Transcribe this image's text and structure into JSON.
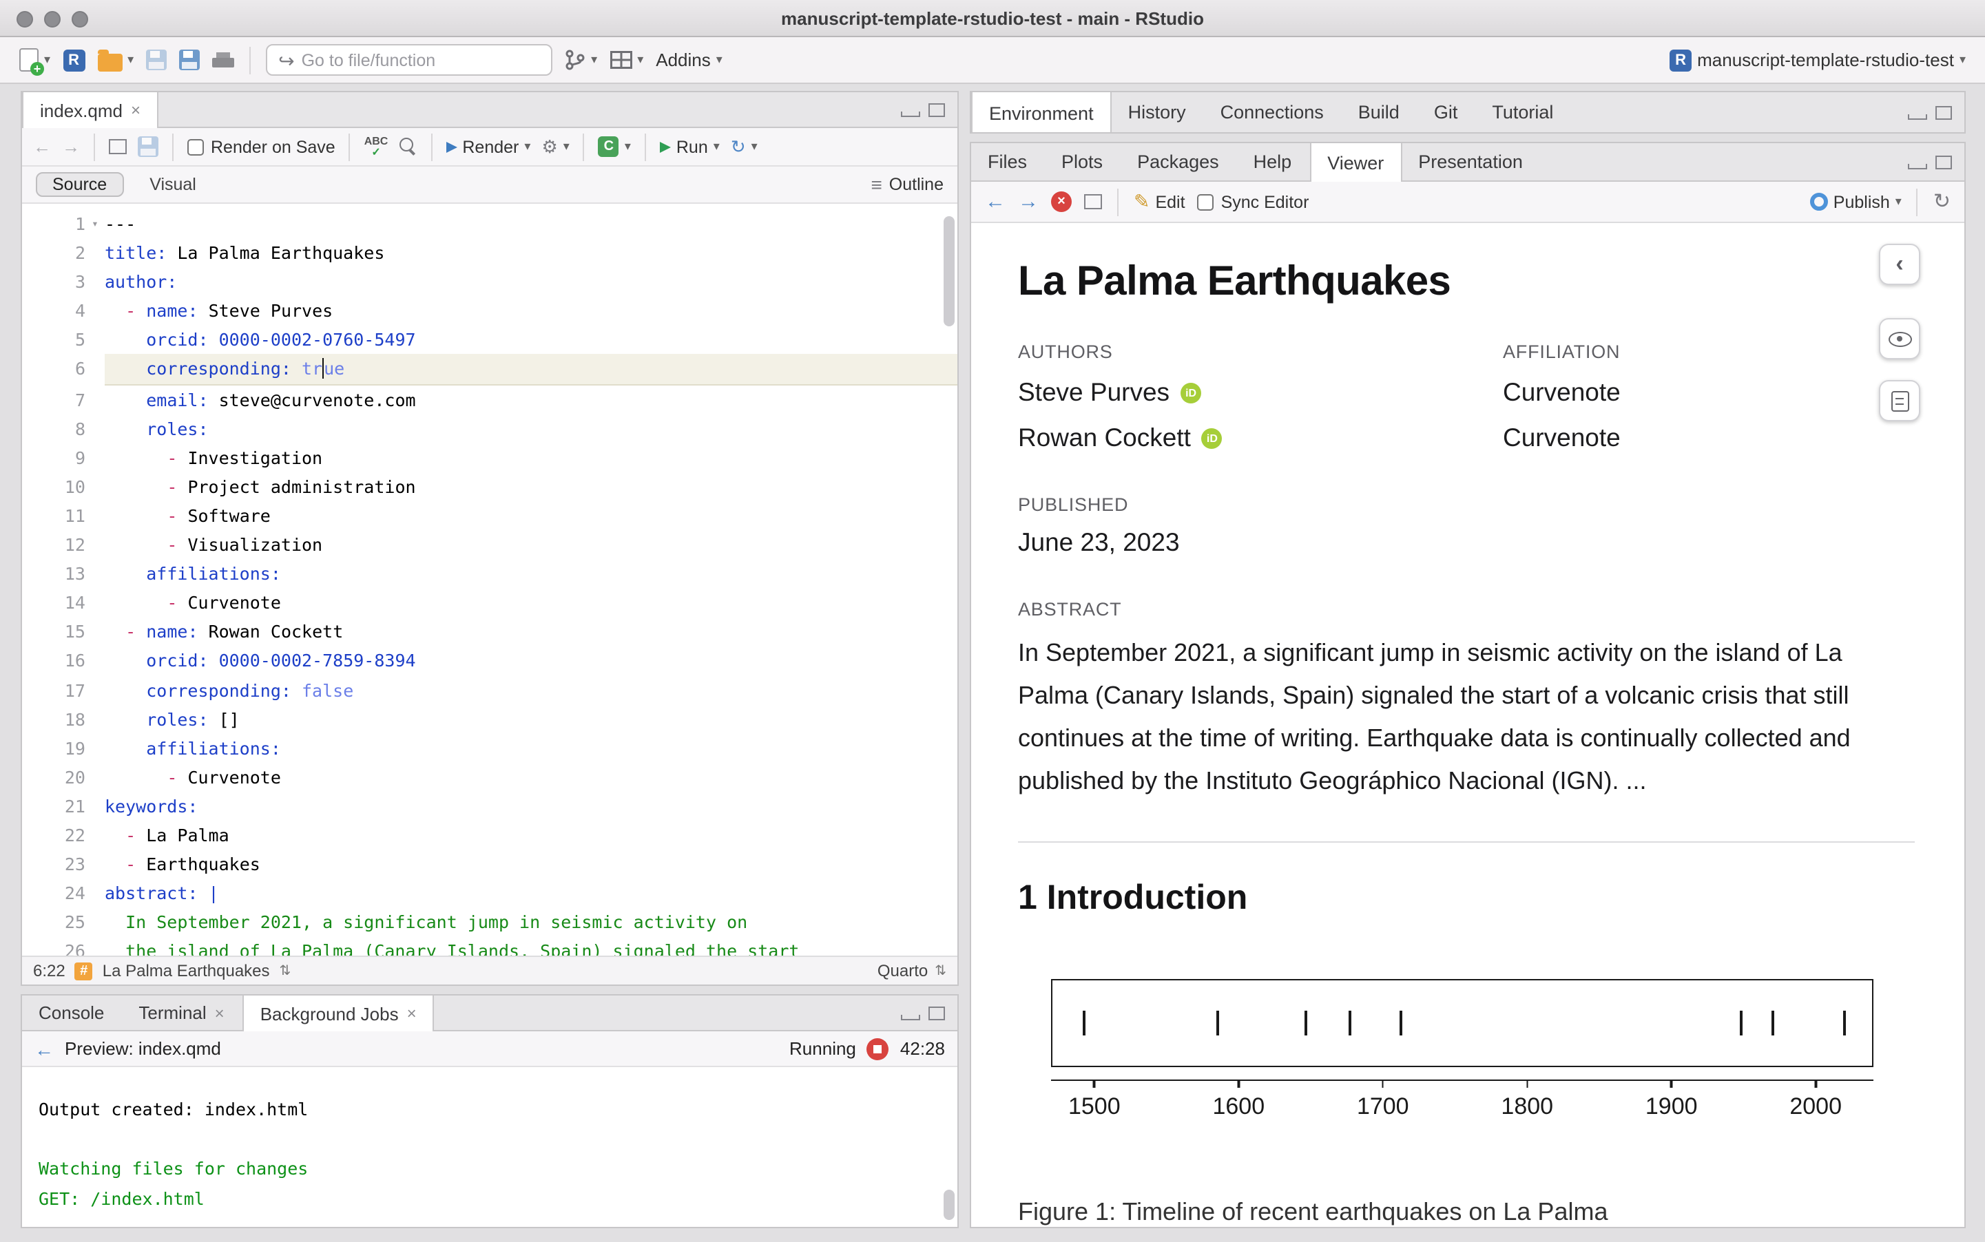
{
  "window": {
    "title": "manuscript-template-rstudio-test - main - RStudio",
    "project": "manuscript-template-rstudio-test"
  },
  "icons": {
    "caret": "▾",
    "back": "←",
    "forward": "→",
    "goto": "↪",
    "gear": "⚙",
    "rerun": "↻",
    "refresh": "↻",
    "pencil": "✎",
    "outline": "≡",
    "spell": "ABC",
    "check": "✓",
    "close": "×",
    "stop_x": "×",
    "chevron_left": "‹",
    "orcid": "iD",
    "hash": "#",
    "updown": "⇅",
    "r_logo": "R",
    "chunk": "C"
  },
  "toolbar": {
    "goto_placeholder": "Go to file/function",
    "addins_label": "Addins"
  },
  "source_pane": {
    "tabs": [
      {
        "label": "index.qmd",
        "closable": true,
        "active": true
      }
    ],
    "toolbar": {
      "render_on_save": "Render on Save",
      "render": "Render",
      "run": "Run"
    },
    "mode_source": "Source",
    "mode_visual": "Visual",
    "outline": "Outline",
    "status": {
      "position": "6:22",
      "symbol": "La Palma Earthquakes",
      "language": "Quarto"
    },
    "lines": [
      {
        "n": 1,
        "fold": true,
        "tokens": [
          [
            "plain",
            "---"
          ]
        ]
      },
      {
        "n": 2,
        "tokens": [
          [
            "key",
            "title:"
          ],
          [
            "plain",
            " La Palma Earthquakes"
          ]
        ]
      },
      {
        "n": 3,
        "tokens": [
          [
            "key",
            "author:"
          ]
        ]
      },
      {
        "n": 4,
        "tokens": [
          [
            "plain",
            "  "
          ],
          [
            "dash",
            "- "
          ],
          [
            "key",
            "name:"
          ],
          [
            "plain",
            " Steve Purves"
          ]
        ]
      },
      {
        "n": 5,
        "tokens": [
          [
            "plain",
            "    "
          ],
          [
            "key",
            "orcid:"
          ],
          [
            "num",
            " 0000-0002-0760-5497"
          ]
        ]
      },
      {
        "n": 6,
        "current": true,
        "tokens": [
          [
            "plain",
            "    "
          ],
          [
            "key",
            "corresponding:"
          ],
          [
            "plain",
            " "
          ],
          [
            "bool",
            "tr"
          ],
          [
            "cursor",
            ""
          ],
          [
            "bool",
            "ue"
          ]
        ]
      },
      {
        "n": 7,
        "tokens": [
          [
            "plain",
            "    "
          ],
          [
            "key",
            "email:"
          ],
          [
            "plain",
            " steve@curvenote.com"
          ]
        ]
      },
      {
        "n": 8,
        "tokens": [
          [
            "plain",
            "    "
          ],
          [
            "key",
            "roles:"
          ]
        ]
      },
      {
        "n": 9,
        "tokens": [
          [
            "plain",
            "      "
          ],
          [
            "dash",
            "- "
          ],
          [
            "plain",
            "Investigation"
          ]
        ]
      },
      {
        "n": 10,
        "tokens": [
          [
            "plain",
            "      "
          ],
          [
            "dash",
            "- "
          ],
          [
            "plain",
            "Project administration"
          ]
        ]
      },
      {
        "n": 11,
        "tokens": [
          [
            "plain",
            "      "
          ],
          [
            "dash",
            "- "
          ],
          [
            "plain",
            "Software"
          ]
        ]
      },
      {
        "n": 12,
        "tokens": [
          [
            "plain",
            "      "
          ],
          [
            "dash",
            "- "
          ],
          [
            "plain",
            "Visualization"
          ]
        ]
      },
      {
        "n": 13,
        "tokens": [
          [
            "plain",
            "    "
          ],
          [
            "key",
            "affiliations:"
          ]
        ]
      },
      {
        "n": 14,
        "tokens": [
          [
            "plain",
            "      "
          ],
          [
            "dash",
            "- "
          ],
          [
            "plain",
            "Curvenote"
          ]
        ]
      },
      {
        "n": 15,
        "tokens": [
          [
            "plain",
            "  "
          ],
          [
            "dash",
            "- "
          ],
          [
            "key",
            "name:"
          ],
          [
            "plain",
            " Rowan Cockett"
          ]
        ]
      },
      {
        "n": 16,
        "tokens": [
          [
            "plain",
            "    "
          ],
          [
            "key",
            "orcid:"
          ],
          [
            "num",
            " 0000-0002-7859-8394"
          ]
        ]
      },
      {
        "n": 17,
        "tokens": [
          [
            "plain",
            "    "
          ],
          [
            "key",
            "corresponding:"
          ],
          [
            "bool",
            " false"
          ]
        ]
      },
      {
        "n": 18,
        "tokens": [
          [
            "plain",
            "    "
          ],
          [
            "key",
            "roles:"
          ],
          [
            "plain",
            " []"
          ]
        ]
      },
      {
        "n": 19,
        "tokens": [
          [
            "plain",
            "    "
          ],
          [
            "key",
            "affiliations:"
          ]
        ]
      },
      {
        "n": 20,
        "tokens": [
          [
            "plain",
            "      "
          ],
          [
            "dash",
            "- "
          ],
          [
            "plain",
            "Curvenote"
          ]
        ]
      },
      {
        "n": 21,
        "tokens": [
          [
            "key",
            "keywords:"
          ]
        ]
      },
      {
        "n": 22,
        "tokens": [
          [
            "plain",
            "  "
          ],
          [
            "dash",
            "- "
          ],
          [
            "plain",
            "La Palma"
          ]
        ]
      },
      {
        "n": 23,
        "tokens": [
          [
            "plain",
            "  "
          ],
          [
            "dash",
            "- "
          ],
          [
            "plain",
            "Earthquakes"
          ]
        ]
      },
      {
        "n": 24,
        "tokens": [
          [
            "key",
            "abstract:"
          ],
          [
            "num",
            " |"
          ]
        ]
      },
      {
        "n": 25,
        "tokens": [
          [
            "str",
            "  In September 2021, a significant jump in seismic activity on"
          ]
        ]
      },
      {
        "n": 26,
        "tokens": [
          [
            "str",
            "  the island of La Palma (Canary Islands, Spain) signaled the start"
          ]
        ]
      }
    ]
  },
  "console_pane": {
    "tabs": [
      {
        "label": "Console",
        "closable": false,
        "active": false
      },
      {
        "label": "Terminal",
        "closable": true,
        "active": false
      },
      {
        "label": "Background Jobs",
        "closable": true,
        "active": true
      }
    ],
    "preview": "Preview: index.qmd",
    "status": "Running",
    "elapsed": "42:28",
    "output": [
      {
        "cls": "plain",
        "text": "Output created: index.html"
      },
      {
        "cls": "plain",
        "text": ""
      },
      {
        "cls": "green",
        "text": "Watching files for changes"
      },
      {
        "cls": "green",
        "text": "GET: /index.html"
      }
    ]
  },
  "env_pane": {
    "tabs": [
      {
        "label": "Environment",
        "active": true
      },
      {
        "label": "History"
      },
      {
        "label": "Connections"
      },
      {
        "label": "Build"
      },
      {
        "label": "Git"
      },
      {
        "label": "Tutorial"
      }
    ]
  },
  "viewer_pane": {
    "tabs": [
      {
        "label": "Files"
      },
      {
        "label": "Plots"
      },
      {
        "label": "Packages"
      },
      {
        "label": "Help"
      },
      {
        "label": "Viewer",
        "active": true
      },
      {
        "label": "Presentation"
      }
    ],
    "edit": "Edit",
    "sync_editor": "Sync Editor",
    "publish": "Publish"
  },
  "document": {
    "title": "La Palma Earthquakes",
    "authors_label": "AUTHORS",
    "affiliation_label": "AFFILIATION",
    "authors": [
      {
        "name": "Steve Purves",
        "affiliation": "Curvenote"
      },
      {
        "name": "Rowan Cockett",
        "affiliation": "Curvenote"
      }
    ],
    "published_label": "PUBLISHED",
    "published": "June 23, 2023",
    "abstract_label": "ABSTRACT",
    "abstract": "In September 2021, a significant jump in seismic activity on the island of La Palma (Canary Islands, Spain) signaled the start of a volcanic crisis that still continues at the time of writing. Earthquake data is continually collected and published by the Instituto Geográphico Nacional (IGN). ...",
    "section_heading": "1 Introduction",
    "figure_caption": "Figure 1: Timeline of recent earthquakes on La Palma"
  },
  "chart_data": {
    "type": "scatter",
    "title": "Timeline of recent earthquakes on La Palma",
    "x": [
      1492,
      1585,
      1646,
      1677,
      1712,
      1949,
      1971,
      2021
    ],
    "xlim": [
      1470,
      2040
    ],
    "xticks": [
      1500,
      1600,
      1700,
      1800,
      1900,
      2000
    ],
    "xlabel": "",
    "ylabel": "",
    "caption": "Figure 1: Timeline of recent earthquakes on La Palma"
  }
}
